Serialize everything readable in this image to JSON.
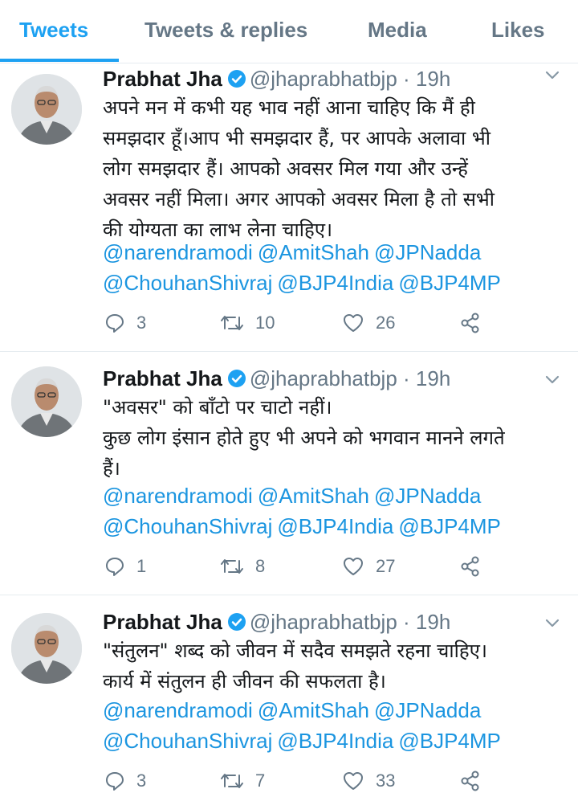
{
  "tabs": [
    {
      "label": "Tweets",
      "active": true
    },
    {
      "label": "Tweets & replies",
      "active": false
    },
    {
      "label": "Media",
      "active": false
    },
    {
      "label": "Likes",
      "active": false
    }
  ],
  "colors": {
    "accent": "#1da1f2",
    "link": "#1b95e0",
    "muted": "#657786"
  },
  "tweets": [
    {
      "name": "Prabhat Jha",
      "handle": "@jhaprabhatbjp",
      "time": "19h",
      "lines": [
        "अपने मन में कभी यह भाव नहीं आना चाहिए कि मैं ही",
        "समझदार हूँ।आप भी समझदार हैं, पर आपके अलावा भी",
        "लोग समझदार हैं। आपको अवसर मिल गया और उन्हें",
        "अवसर नहीं मिला। अगर आपको अवसर मिला है तो सभी",
        "की योग्यता का लाभ लेना चाहिए।"
      ],
      "mentions": [
        "@narendramodi",
        "@AmitShah",
        "@JPNadda",
        "@ChouhanShivraj",
        "@BJP4India",
        "@BJP4MP"
      ],
      "replies": "3",
      "retweets": "10",
      "likes": "26"
    },
    {
      "name": "Prabhat Jha",
      "handle": "@jhaprabhatbjp",
      "time": "19h",
      "lines": [
        "\"अवसर\" को बाँटो पर चाटो नहीं।",
        "कुछ लोग इंसान होते हुए भी अपने को भगवान मानने लगते",
        "हैं।"
      ],
      "mentions": [
        "@narendramodi",
        "@AmitShah",
        "@JPNadda",
        "@ChouhanShivraj",
        "@BJP4India",
        "@BJP4MP"
      ],
      "replies": "1",
      "retweets": "8",
      "likes": "27"
    },
    {
      "name": "Prabhat Jha",
      "handle": "@jhaprabhatbjp",
      "time": "19h",
      "lines": [
        "\"संतुलन\" शब्द को जीवन में सदैव समझते रहना चाहिए।",
        "कार्य में संतुलन ही जीवन की सफलता है।"
      ],
      "mentions": [
        "@narendramodi",
        "@AmitShah",
        "@JPNadda",
        "@ChouhanShivraj",
        "@BJP4India",
        "@BJP4MP"
      ],
      "replies": "3",
      "retweets": "7",
      "likes": "33"
    }
  ]
}
